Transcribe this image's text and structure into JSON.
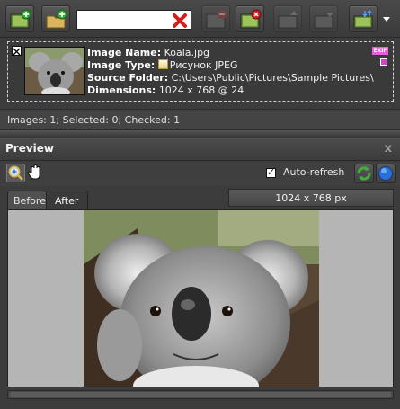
{
  "toolbar": {
    "search_value": "",
    "buttons": [
      "add-images",
      "add-folder",
      "clear-search",
      "remove",
      "remove-all",
      "move-up",
      "move-down",
      "options"
    ]
  },
  "card": {
    "image_name_label": "Image Name:",
    "image_name": "Koala.jpg",
    "image_type_label": "Image Type:",
    "image_type": "Рисунок JPEG",
    "source_folder_label": "Source Folder:",
    "source_folder": "C:\\Users\\Public\\Pictures\\Sample Pictures\\",
    "dimensions_label": "Dimensions:",
    "dimensions": "1024 x 768 @ 24",
    "exif_badge": "EXIF"
  },
  "status": {
    "text": "Images: 1; Selected: 0; Checked: 1"
  },
  "preview": {
    "title": "Preview",
    "close": "x",
    "auto_refresh_label": "Auto-refresh",
    "auto_refresh_checked": true,
    "tabs": [
      {
        "label": "Before"
      },
      {
        "label": "After"
      }
    ],
    "dimensions_display": "1024 x 768 px"
  },
  "colors": {
    "background": "#3c3c3c",
    "exif_badge": "#e85fd8",
    "clear_x": "#d2201c",
    "refresh_green": "#3fae3a",
    "globe_blue": "#2b6fd6"
  },
  "icons": {
    "search_clear": "red-x-icon",
    "zoom": "magnifier-icon",
    "pan": "hand-icon",
    "refresh": "refresh-icon",
    "globe": "globe-icon"
  }
}
